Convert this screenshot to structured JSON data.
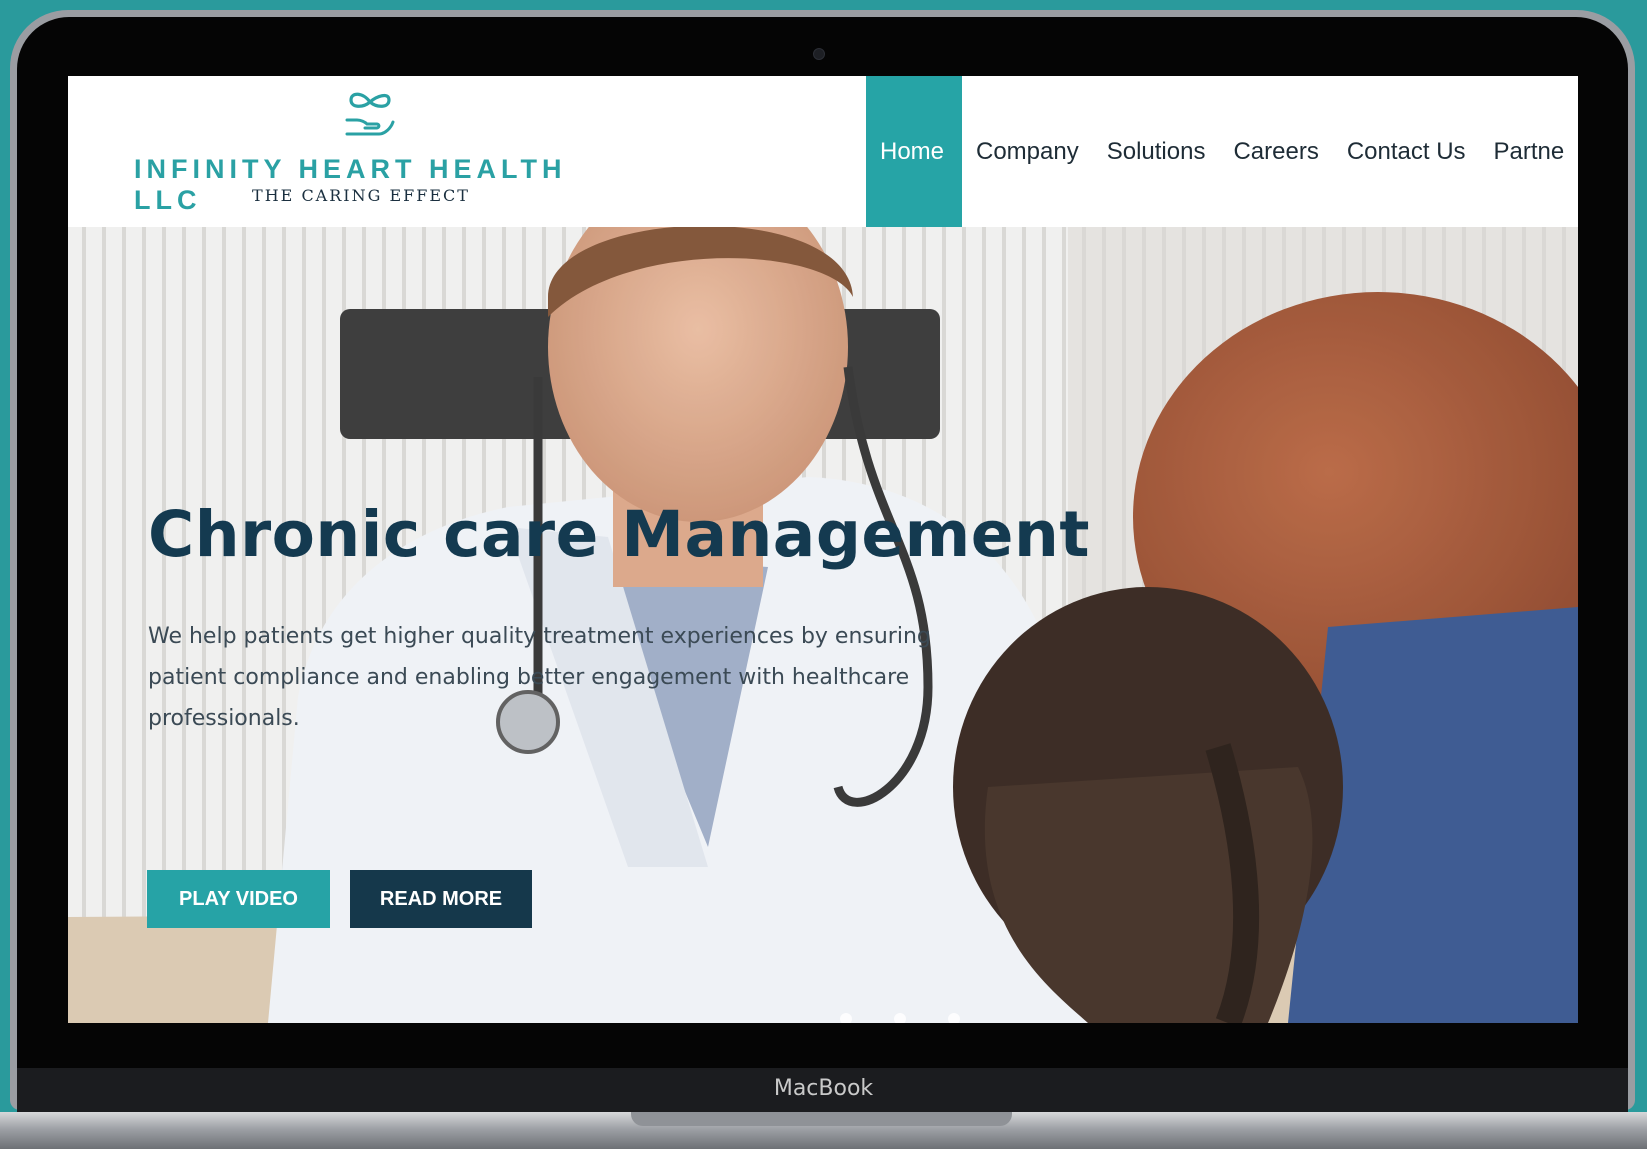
{
  "device": {
    "label": "MacBook"
  },
  "brand": {
    "name": "INFINITY HEART HEALTH LLC",
    "tagline": "THE CARING EFFECT",
    "logo_icon": "infinity-hand-icon",
    "accent_color": "#26a4a6",
    "dark_color": "#15384b"
  },
  "nav": {
    "items": [
      {
        "label": "Home",
        "active": true
      },
      {
        "label": "Company"
      },
      {
        "label": "Solutions"
      },
      {
        "label": "Careers"
      },
      {
        "label": "Contact Us"
      },
      {
        "label": "Partne"
      }
    ]
  },
  "hero": {
    "title": "Chronic care Management",
    "description": "We help patients get higher quality treatment experiences by ensuring patient compliance and enabling better engagement with healthcare professionals.",
    "buttons": {
      "play": "PLAY VIDEO",
      "read": "READ MORE"
    },
    "slides": 3
  }
}
